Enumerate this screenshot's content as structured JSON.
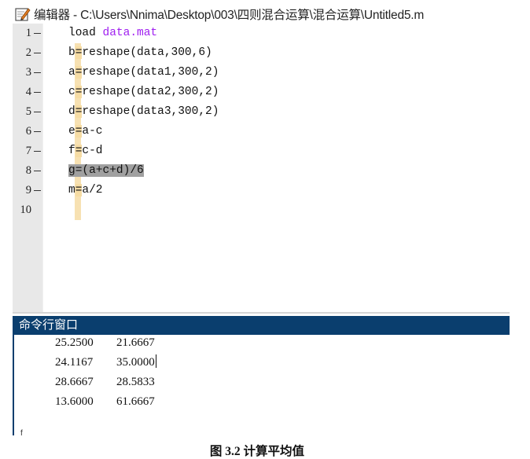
{
  "window": {
    "title": "编辑器 - C:\\Users\\Nnima\\Desktop\\003\\四则混合运算\\混合运算\\Untitled5.m",
    "icon": "edit-pencil-icon"
  },
  "editor": {
    "lines": [
      {
        "num": "1",
        "parts": [
          {
            "t": "load ",
            "c": ""
          },
          {
            "t": "data.mat",
            "c": "kw"
          }
        ]
      },
      {
        "num": "2",
        "parts": [
          {
            "t": "b",
            "c": ""
          },
          {
            "t": "=",
            "c": "eq"
          },
          {
            "t": "reshape(data,300,6)",
            "c": ""
          }
        ]
      },
      {
        "num": "3",
        "parts": [
          {
            "t": "a",
            "c": ""
          },
          {
            "t": "=",
            "c": "eq"
          },
          {
            "t": "reshape(data1,300,2)",
            "c": ""
          }
        ]
      },
      {
        "num": "4",
        "parts": [
          {
            "t": "c",
            "c": ""
          },
          {
            "t": "=",
            "c": "eq"
          },
          {
            "t": "reshape(data2,300,2)",
            "c": ""
          }
        ]
      },
      {
        "num": "5",
        "parts": [
          {
            "t": "d",
            "c": ""
          },
          {
            "t": "=",
            "c": "eq"
          },
          {
            "t": "reshape(data3,300,2)",
            "c": ""
          }
        ]
      },
      {
        "num": "6",
        "parts": [
          {
            "t": "e",
            "c": ""
          },
          {
            "t": "=",
            "c": "eq"
          },
          {
            "t": "a-c",
            "c": ""
          }
        ]
      },
      {
        "num": "7",
        "parts": [
          {
            "t": "f",
            "c": ""
          },
          {
            "t": "=",
            "c": "eq"
          },
          {
            "t": "c-d",
            "c": ""
          }
        ]
      },
      {
        "num": "8",
        "parts": [
          {
            "t": "g=(a+c+d)/6",
            "c": "sel"
          }
        ]
      },
      {
        "num": "9",
        "parts": [
          {
            "t": "m",
            "c": ""
          },
          {
            "t": "=",
            "c": "eq"
          },
          {
            "t": "a/2",
            "c": ""
          }
        ]
      },
      {
        "num": "10",
        "parts": []
      }
    ]
  },
  "command_window": {
    "title": "命令行窗口",
    "rows": [
      [
        "25.2500",
        "21.6667"
      ],
      [
        "24.1167",
        "35.0000"
      ],
      [
        "28.6667",
        "28.5833"
      ],
      [
        "13.6000",
        "61.6667"
      ]
    ],
    "prompt": "f"
  },
  "caption": "图 3.2  计算平均值"
}
